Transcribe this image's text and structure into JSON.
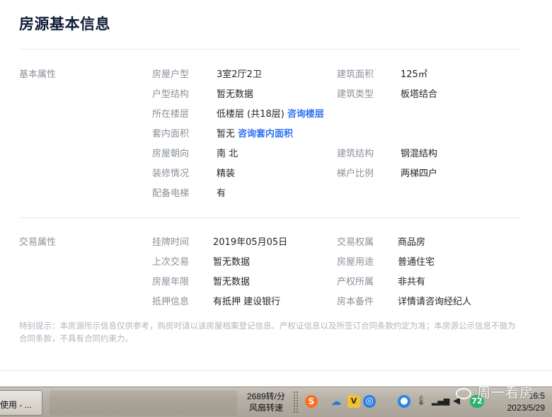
{
  "page": {
    "title": "房源基本信息"
  },
  "basic": {
    "section_label": "基本属性",
    "fields": {
      "layout": {
        "label": "房屋户型",
        "value": "3室2厅2卫"
      },
      "building_area": {
        "label": "建筑面积",
        "value": "125㎡"
      },
      "structure": {
        "label": "户型结构",
        "value": "暂无数据"
      },
      "building_type": {
        "label": "建筑类型",
        "value": "板塔结合"
      },
      "floor": {
        "label": "所在楼层",
        "value": "低楼层 (共18层)",
        "link": "咨询楼层"
      },
      "inner_area": {
        "label": "套内面积",
        "value": "暂无",
        "link": "咨询套内面积"
      },
      "orientation": {
        "label": "房屋朝向",
        "value": "南 北"
      },
      "construction": {
        "label": "建筑结构",
        "value": "钢混结构"
      },
      "decoration": {
        "label": "装修情况",
        "value": "精装"
      },
      "elevator_ratio": {
        "label": "梯户比例",
        "value": "两梯四户"
      },
      "elevator": {
        "label": "配备电梯",
        "value": "有"
      }
    }
  },
  "transaction": {
    "section_label": "交易属性",
    "fields": {
      "listing_time": {
        "label": "挂牌时间",
        "value": "2019年05月05日"
      },
      "ownership": {
        "label": "交易权属",
        "value": "商品房"
      },
      "last_trade": {
        "label": "上次交易",
        "value": "暂无数据"
      },
      "usage": {
        "label": "房屋用途",
        "value": "普通住宅"
      },
      "years": {
        "label": "房屋年限",
        "value": "暂无数据"
      },
      "property_right": {
        "label": "产权所属",
        "value": "非共有"
      },
      "mortgage": {
        "label": "抵押信息",
        "value": "有抵押 建设银行"
      },
      "record": {
        "label": "房本备件",
        "value": "详情请咨询经纪人"
      }
    }
  },
  "notice": "特别提示：本房源所示信息仅供参考，购房时请以该房屋档案登记信息、产权证信息以及所签订合同条款约定为准；本房源公示信息不做为合同条款，不具有合同约束力。",
  "taskbar": {
    "task_label": "使用 - ...",
    "fan_speed": "2689转/分",
    "fan_label": "风扇转速",
    "badge": "72",
    "time": "16:5",
    "date": "2023/5/29",
    "watermark": "周一看房"
  },
  "icons": [
    "sogou-icon",
    "cloud-icon",
    "vpn-icon",
    "network-icon",
    "qq-icon",
    "thermometer-icon",
    "signal-icon",
    "volume-icon"
  ]
}
